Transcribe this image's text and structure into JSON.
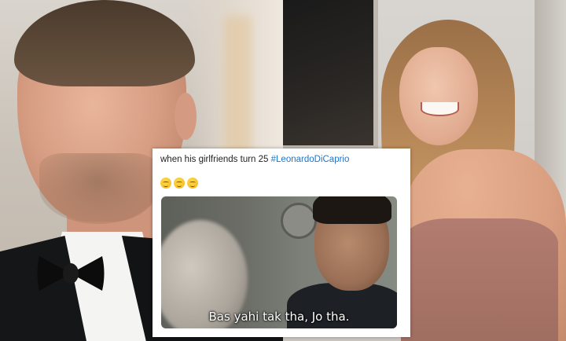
{
  "tweet": {
    "text": "when his girlfriends turn 25",
    "hashtag": "#LeonardoDiCaprio",
    "emojis": [
      "grinning-sweat-emoji",
      "grinning-sweat-emoji",
      "grinning-sweat-emoji"
    ],
    "hashtag_color": "#1d74c9"
  },
  "meme": {
    "caption": "Bas yahi tak tha, Jo tha."
  }
}
